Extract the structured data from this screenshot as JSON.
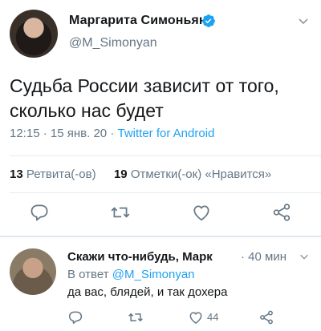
{
  "tweet": {
    "author_name": "Маргарита Симоньян",
    "handle": "@M_Simonyan",
    "text_line1": "Судьба России зависит от того,",
    "text_line2": "сколько нас будет",
    "time": "12:15",
    "date": "15 янв. 20",
    "client": "Twitter for Android",
    "retweets_count": "13",
    "retweets_label": "Ретвита(-ов)",
    "likes_count": "19",
    "likes_label": "Отметки(-ок) «Нравится»",
    "actions": [
      "reply-icon",
      "retweet-icon",
      "like-icon",
      "share-icon"
    ]
  },
  "reply": {
    "author_name": "Скажи что-нибудь, Марк",
    "time": "40 мин",
    "reply_to_prefix": "В ответ",
    "reply_to_handle": "@M_Simonyan",
    "text": "да вас, блядей, и так дохера",
    "likes": "44"
  },
  "colors": {
    "accent": "#1da1f2",
    "muted": "#657786",
    "text": "#14171a",
    "divider": "#e6ecf0"
  }
}
